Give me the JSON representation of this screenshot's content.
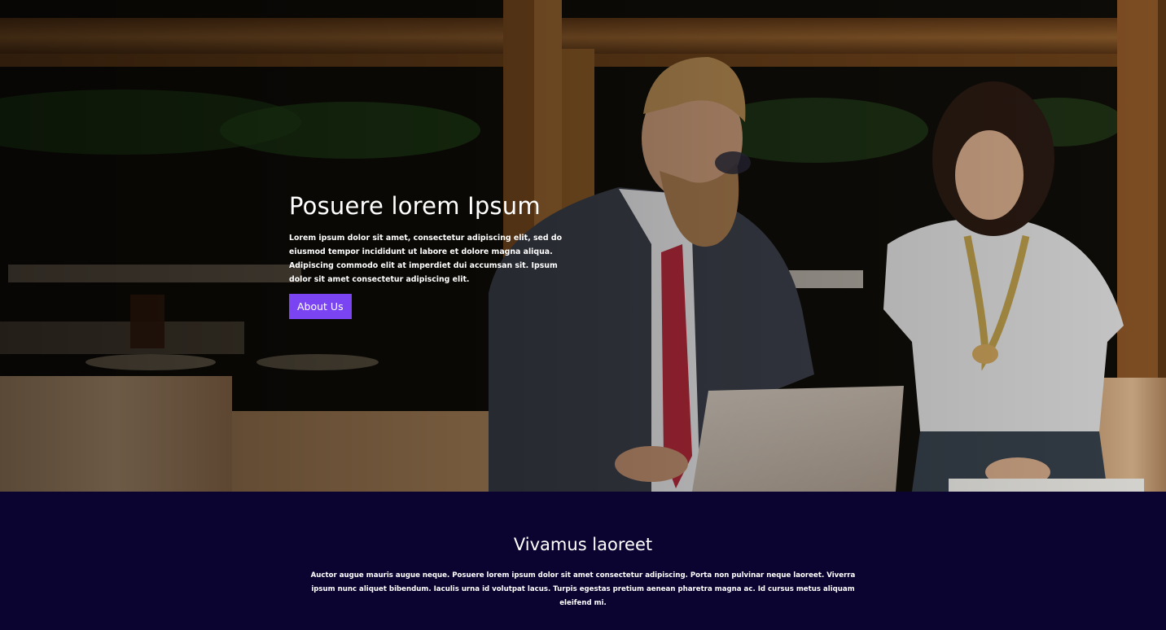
{
  "hero": {
    "title": "Posuere lorem Ipsum",
    "text": "Lorem ipsum dolor sit amet, consectetur adipiscing elit, sed do eiusmod tempor incididunt ut labore et dolore magna aliqua. Adipiscing commodo elit at imperdiet dui accumsan sit. Ipsum dolor sit amet consectetur adipiscing elit.",
    "button_label": "About Us",
    "image_icon": "business-meeting-photo"
  },
  "section": {
    "title": "Vivamus laoreet",
    "text": "Auctor augue mauris augue neque. Posuere lorem ipsum dolor sit amet consectetur adipiscing. Porta non pulvinar neque laoreet. Viverra ipsum nunc aliquet bibendum. Iaculis urna id volutpat lacus. Turpis egestas pretium aenean pharetra magna ac. Id cursus metus aliquam eleifend mi."
  },
  "colors": {
    "accent": "#7a44f2",
    "section_background": "#0b0330",
    "text": "#ffffff"
  }
}
